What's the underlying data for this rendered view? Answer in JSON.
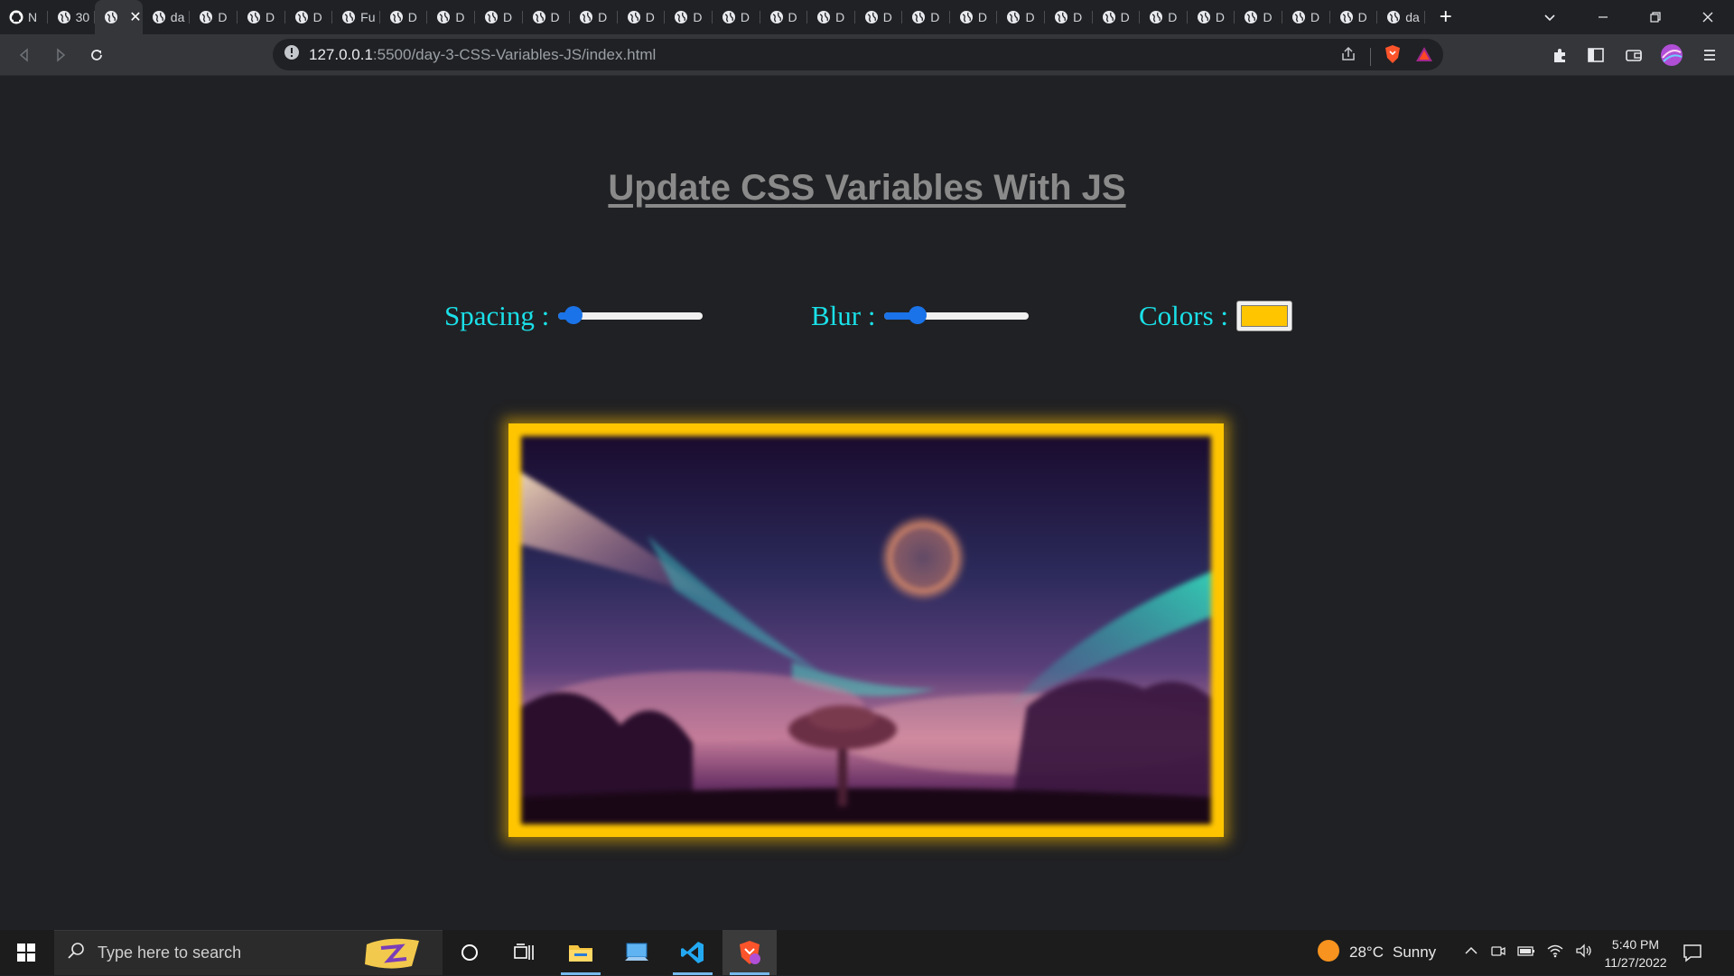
{
  "browser": {
    "tabs": [
      {
        "label": "N",
        "icon": "github-icon"
      },
      {
        "label": "30",
        "icon": "globe-icon"
      },
      {
        "label": "",
        "icon": "globe-icon",
        "active": true
      },
      {
        "label": "da",
        "icon": "globe-icon"
      },
      {
        "label": "D",
        "icon": "globe-icon"
      },
      {
        "label": "D",
        "icon": "globe-icon"
      },
      {
        "label": "D",
        "icon": "globe-icon"
      },
      {
        "label": "Fu",
        "icon": "globe-icon"
      },
      {
        "label": "D",
        "icon": "globe-icon"
      },
      {
        "label": "D",
        "icon": "globe-icon"
      },
      {
        "label": "D",
        "icon": "globe-icon"
      },
      {
        "label": "D",
        "icon": "globe-icon"
      },
      {
        "label": "D",
        "icon": "globe-icon"
      },
      {
        "label": "D",
        "icon": "globe-icon"
      },
      {
        "label": "D",
        "icon": "globe-icon"
      },
      {
        "label": "D",
        "icon": "globe-icon"
      },
      {
        "label": "D",
        "icon": "globe-icon"
      },
      {
        "label": "D",
        "icon": "globe-icon"
      },
      {
        "label": "D",
        "icon": "globe-icon"
      },
      {
        "label": "D",
        "icon": "globe-icon"
      },
      {
        "label": "D",
        "icon": "globe-icon"
      },
      {
        "label": "D",
        "icon": "globe-icon"
      },
      {
        "label": "D",
        "icon": "globe-icon"
      },
      {
        "label": "D",
        "icon": "globe-icon"
      },
      {
        "label": "D",
        "icon": "globe-icon"
      },
      {
        "label": "D",
        "icon": "globe-icon"
      },
      {
        "label": "D",
        "icon": "globe-icon"
      },
      {
        "label": "D",
        "icon": "globe-icon"
      },
      {
        "label": "D",
        "icon": "globe-icon"
      },
      {
        "label": "da",
        "icon": "globe-icon"
      }
    ],
    "new_tab": "+",
    "url_host": "127.0.0.1",
    "url_path": ":5500/day-3-CSS-Variables-JS/index.html"
  },
  "page": {
    "title": "Update CSS Variables With JS",
    "spacing_label": "Spacing :",
    "blur_label": "Blur :",
    "colors_label": "Colors :",
    "spacing_value": 0.05,
    "blur_value": 0.19,
    "color_value": "#ffc600"
  },
  "taskbar": {
    "search_placeholder": "Type here to search",
    "weather_temp": "28°C",
    "weather_desc": "Sunny",
    "time": "5:40 PM",
    "date": "11/27/2022"
  },
  "colors": {
    "accent": "#1a73e8",
    "label": "#1ae0e8",
    "frame": "#ffc600"
  }
}
